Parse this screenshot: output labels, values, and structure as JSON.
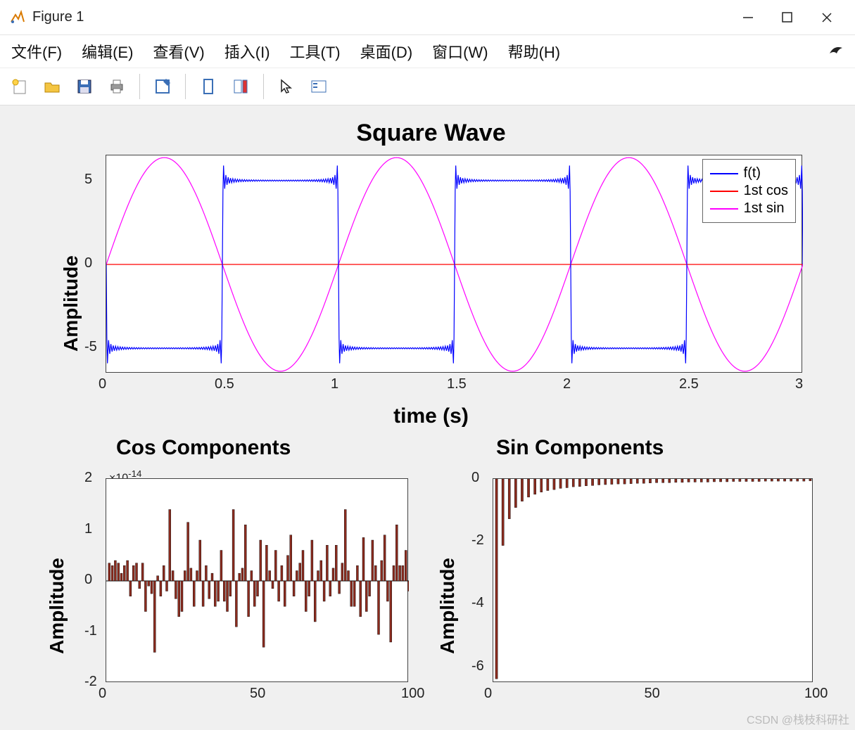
{
  "window": {
    "title": "Figure 1"
  },
  "menu": {
    "file": "文件(F)",
    "edit": "编辑(E)",
    "view": "查看(V)",
    "insert": "插入(I)",
    "tools": "工具(T)",
    "desktop": "桌面(D)",
    "window": "窗口(W)",
    "help": "帮助(H)"
  },
  "watermark": "CSDN @栈枝科研社",
  "chart_data": [
    {
      "type": "line",
      "title": "Square Wave",
      "xlabel": "time (s)",
      "ylabel": "Amplitude",
      "xlim": [
        0,
        3
      ],
      "ylim": [
        -6.5,
        6.5
      ],
      "xticks": [
        0,
        0.5,
        1,
        1.5,
        2,
        2.5,
        3
      ],
      "yticks": [
        -5,
        0,
        5
      ],
      "legend": [
        "f(t)",
        "1st cos",
        "1st sin"
      ],
      "colors": {
        "f(t)": "#0000ff",
        "1st cos": "#ff0000",
        "1st sin": "#ff00ff"
      },
      "series": [
        {
          "name": "f(t)",
          "description": "square wave period 1s amplitude 5 with Gibbs ringing at edges",
          "amplitude": 5,
          "period": 1
        },
        {
          "name": "1st cos",
          "description": "zero line",
          "constant": 0
        },
        {
          "name": "1st sin",
          "description": "fundamental sine",
          "amplitude": 6.37,
          "period": 1
        }
      ]
    },
    {
      "type": "bar",
      "title": "Cos Components",
      "ylabel": "Amplitude",
      "xlim": [
        0,
        100
      ],
      "ylim": [
        -2,
        2
      ],
      "xticks": [
        0,
        50,
        100
      ],
      "yticks": [
        -2,
        -1,
        0,
        1,
        2
      ],
      "y_exponent_label": "×10⁻¹⁴",
      "bar_color": "#8b2b1e",
      "x": [
        1,
        2,
        3,
        4,
        5,
        6,
        7,
        8,
        9,
        10,
        11,
        12,
        13,
        14,
        15,
        16,
        17,
        18,
        19,
        20,
        21,
        22,
        23,
        24,
        25,
        26,
        27,
        28,
        29,
        30,
        31,
        32,
        33,
        34,
        35,
        36,
        37,
        38,
        39,
        40,
        41,
        42,
        43,
        44,
        45,
        46,
        47,
        48,
        49,
        50,
        51,
        52,
        53,
        54,
        55,
        56,
        57,
        58,
        59,
        60,
        61,
        62,
        63,
        64,
        65,
        66,
        67,
        68,
        69,
        70,
        71,
        72,
        73,
        74,
        75,
        76,
        77,
        78,
        79,
        80,
        81,
        82,
        83,
        84,
        85,
        86,
        87,
        88,
        89,
        90,
        91,
        92,
        93,
        94,
        95,
        96,
        97,
        98,
        99,
        100
      ],
      "values": [
        0.35,
        0.3,
        0.4,
        0.35,
        0.15,
        0.3,
        0.4,
        -0.3,
        0.3,
        0.35,
        -0.15,
        0.35,
        -0.6,
        -0.1,
        -0.25,
        -1.4,
        0.1,
        -0.3,
        0.3,
        -0.2,
        1.4,
        0.2,
        -0.35,
        -0.7,
        -0.6,
        0.2,
        1.15,
        0.25,
        -0.5,
        0.2,
        0.8,
        -0.5,
        0.3,
        -0.35,
        0.15,
        -0.5,
        -0.4,
        0.6,
        -0.4,
        -0.6,
        -0.3,
        1.4,
        -0.9,
        0.15,
        0.25,
        1.1,
        -0.7,
        0.2,
        -0.5,
        -0.3,
        0.8,
        -1.3,
        0.7,
        0.2,
        -0.15,
        0.6,
        -0.4,
        0.3,
        -0.5,
        0.5,
        0.9,
        -0.3,
        0.2,
        0.35,
        0.6,
        -0.6,
        -0.3,
        0.8,
        -0.8,
        0.2,
        0.4,
        -0.4,
        0.7,
        -0.3,
        0.25,
        0.7,
        -0.25,
        0.35,
        1.4,
        0.2,
        -0.5,
        -0.5,
        0.3,
        -0.7,
        0.85,
        -0.6,
        -0.3,
        0.8,
        0.3,
        -1.05,
        0.4,
        0.9,
        -0.4,
        -1.2,
        0.3,
        1.1,
        0.3,
        0.3,
        0.6,
        -0.2
      ]
    },
    {
      "type": "bar",
      "title": "Sin Components",
      "ylabel": "Amplitude",
      "xlim": [
        0,
        100
      ],
      "ylim": [
        -6.5,
        0
      ],
      "xticks": [
        0,
        50,
        100
      ],
      "yticks": [
        -6,
        -4,
        -2,
        0
      ],
      "bar_color": "#8b2b1e",
      "x": [
        1,
        3,
        5,
        7,
        9,
        11,
        13,
        15,
        17,
        19,
        21,
        23,
        25,
        27,
        29,
        31,
        33,
        35,
        37,
        39,
        41,
        43,
        45,
        47,
        49,
        51,
        53,
        55,
        57,
        59,
        61,
        63,
        65,
        67,
        69,
        71,
        73,
        75,
        77,
        79,
        81,
        83,
        85,
        87,
        89,
        91,
        93,
        95,
        97,
        99
      ],
      "values": [
        -6.37,
        -2.12,
        -1.27,
        -0.91,
        -0.71,
        -0.58,
        -0.49,
        -0.42,
        -0.37,
        -0.34,
        -0.3,
        -0.28,
        -0.25,
        -0.24,
        -0.22,
        -0.21,
        -0.19,
        -0.18,
        -0.17,
        -0.16,
        -0.16,
        -0.15,
        -0.14,
        -0.14,
        -0.13,
        -0.12,
        -0.12,
        -0.12,
        -0.11,
        -0.11,
        -0.1,
        -0.1,
        -0.1,
        -0.1,
        -0.09,
        -0.09,
        -0.09,
        -0.08,
        -0.08,
        -0.08,
        -0.08,
        -0.08,
        -0.07,
        -0.07,
        -0.07,
        -0.07,
        -0.07,
        -0.07,
        -0.07,
        -0.06
      ]
    }
  ]
}
